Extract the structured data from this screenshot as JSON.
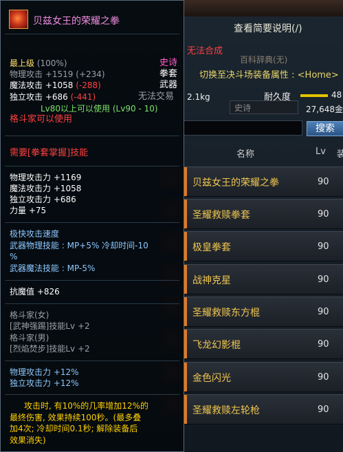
{
  "shop": {
    "info_link": "查看简要说明(/)",
    "hint_text": "百科辞典(无)",
    "switch_text": "切换至决斗场装备属性 : <Home>",
    "weight": "2.1kg",
    "durability_label": "耐久度",
    "durability_value": "48",
    "filter_value": "史诗",
    "money": "27,648金",
    "search_button": "搜索",
    "columns": {
      "name": "名称",
      "lv": "Lv",
      "extra": "装"
    },
    "rows": [
      {
        "name": "贝兹女王的荣耀之拳",
        "lv": "90"
      },
      {
        "name": "圣耀救赎拳套",
        "lv": "90"
      },
      {
        "name": "极皇拳套",
        "lv": "90"
      },
      {
        "name": "战神克星",
        "lv": "90"
      },
      {
        "name": "圣耀救赎东方棍",
        "lv": "90"
      },
      {
        "name": "飞龙幻影棍",
        "lv": "90"
      },
      {
        "name": "金色闪光",
        "lv": "90"
      },
      {
        "name": "圣耀救赎左轮枪",
        "lv": "90"
      }
    ]
  },
  "tooltip": {
    "title": "贝兹女王的荣耀之拳",
    "grade": "最上级",
    "grade_pct": "(100%)",
    "rarity": "史诗",
    "cannot_combine": "无法合成",
    "type": "拳套",
    "category": "武器",
    "no_trade": "无法交易",
    "phys_atk_label": "物理攻击",
    "phys_atk_value": "+1519",
    "phys_atk_delta": "(+234)",
    "mag_atk_label": "魔法攻击",
    "mag_atk_value": "+1058",
    "mag_atk_delta": "(-288)",
    "ind_atk_label": "独立攻击",
    "ind_atk_value": "+686",
    "ind_atk_delta": "(-441)",
    "level_req": "Lv80以上可以使用 (Lv90 - 10)",
    "class_req": "格斗家可以使用",
    "skill_req": "需要[拳套掌握]技能",
    "stat_phys": "物理攻击力 +1169",
    "stat_mag": "魔法攻击力 +1058",
    "stat_ind": "独立攻击力 +686",
    "stat_str": "力量 +75",
    "speed_title": "极快攻击速度",
    "weapon_phys_skill_1": "武器物理技能 : MP+5% 冷却时间-10",
    "weapon_phys_skill_2": "%",
    "weapon_mag_skill": "武器魔法技能 : MP-5%",
    "anti_magic": "抗魔值 +826",
    "class_f": "格斗家(女)",
    "skill_f": "[武神强踢]技能Lv +2",
    "class_m": "格斗家(男)",
    "skill_m": "[烈焰焚步]技能Lv +2",
    "bonus_phys": "物理攻击力 +12%",
    "bonus_ind": "独立攻击力 +12%",
    "desc_1": "攻击时, 有10%的几率增加12%的",
    "desc_2": "最终伤害, 效果持续100秒。(最多叠",
    "desc_3": "加4次; 冷却时间0.1秒; 解除装备后",
    "desc_4": "效果消失)"
  }
}
